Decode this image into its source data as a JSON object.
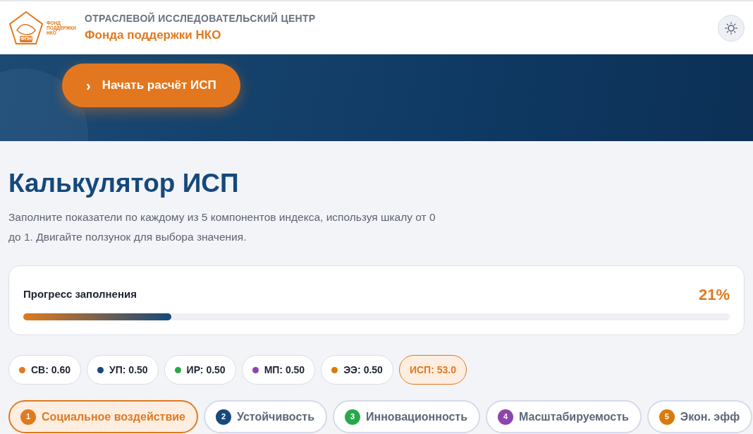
{
  "header": {
    "logo": {
      "side_text": [
        "ФОНД",
        "ПОДДЕРЖКИ",
        "НКО"
      ],
      "badge": "ФПН"
    },
    "subtitle": "ОТРАСЛЕВОЙ ИССЛЕДОВАТЕЛЬСКИЙ ЦЕНТР",
    "title": "Фонда поддержки НКО"
  },
  "hero": {
    "button": {
      "icon": "›",
      "label": "Начать расчёт ИСП"
    }
  },
  "page": {
    "title": "Калькулятор ИСП",
    "description": "Заполните показатели по каждому из 5 компонентов индекса, используя шкалу от 0 до 1. Двигайте ползунок для выбора значения."
  },
  "progress": {
    "label": "Прогресс заполнения",
    "percent": "21%",
    "level": 0.21
  },
  "summary": [
    {
      "kind": "component",
      "label": "СВ: 0.60",
      "color": "#e07a1f"
    },
    {
      "kind": "component",
      "label": "УП: 0.50",
      "color": "#17497e"
    },
    {
      "kind": "component",
      "label": "ИР: 0.50",
      "color": "#29a84a"
    },
    {
      "kind": "component",
      "label": "МП: 0.50",
      "color": "#8e44ad"
    },
    {
      "kind": "component",
      "label": "ЭЭ: 0.50",
      "color": "#d97a0c"
    },
    {
      "kind": "total",
      "label": "ИСП: 53.0"
    }
  ],
  "tabs": [
    {
      "number": "1",
      "label": "Социальное воздействие",
      "color": "#e07a1f",
      "selected": true
    },
    {
      "number": "2",
      "label": "Устойчивость",
      "color": "#17497e",
      "selected": false
    },
    {
      "number": "3",
      "label": "Инновационность",
      "color": "#29a84a",
      "selected": false
    },
    {
      "number": "4",
      "label": "Масштабируемость",
      "color": "#8e44ad",
      "selected": false
    },
    {
      "number": "5",
      "label": "Экон. эфф",
      "color": "#d97a0c",
      "selected": false
    }
  ]
}
